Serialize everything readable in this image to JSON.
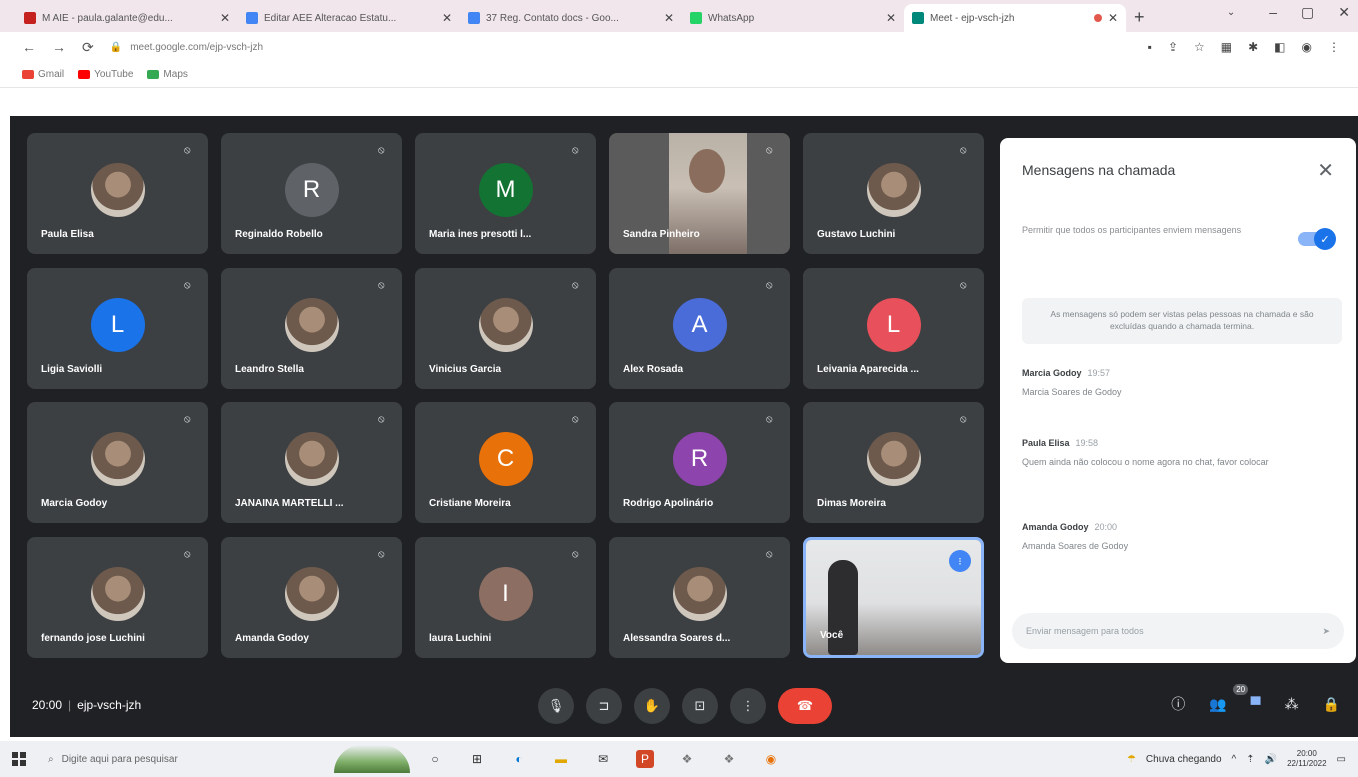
{
  "browser": {
    "tabs": [
      {
        "title": "M AIE - paula.galante@edu...",
        "color": "#c5221f"
      },
      {
        "title": "Editar AEE Alteracao Estatu...",
        "color": "#4285f4"
      },
      {
        "title": "37 Reg. Contato docs - Goo...",
        "color": "#4285f4"
      },
      {
        "title": "WhatsApp",
        "color": "#25d366"
      },
      {
        "title": "Meet - ejp-vsch-jzh",
        "color": "#00897b"
      }
    ],
    "new_tab": "+",
    "window_buttons": [
      "⌄",
      "–",
      "▢",
      "✕"
    ],
    "url": "meet.google.com/ejp-vsch-jzh",
    "bookmarks": [
      {
        "label": "Gmail",
        "color": "#ea4335"
      },
      {
        "label": "YouTube",
        "color": "#ff0000"
      },
      {
        "label": "Maps",
        "color": "#34a853"
      }
    ]
  },
  "meeting": {
    "code": "ejp-vsch-jzh",
    "time": "20:00",
    "participants": [
      {
        "name": "Paula Elisa",
        "type": "photo"
      },
      {
        "name": "Reginaldo Robello",
        "type": "initial",
        "initial": "R",
        "color": "#5f6368"
      },
      {
        "name": "Maria ines presotti l...",
        "type": "initial",
        "initial": "M",
        "color": "#137333"
      },
      {
        "name": "Sandra Pinheiro",
        "type": "video"
      },
      {
        "name": "Gustavo Luchini",
        "type": "photo"
      },
      {
        "name": "Ligia Saviolli",
        "type": "initial",
        "initial": "L",
        "color": "#1a73e8"
      },
      {
        "name": "Leandro Stella",
        "type": "photo"
      },
      {
        "name": "Vinicius Garcia",
        "type": "photo"
      },
      {
        "name": "Alex Rosada",
        "type": "initial",
        "initial": "A",
        "color": "#4a6cd8"
      },
      {
        "name": "Leivania Aparecida ...",
        "type": "initial",
        "initial": "L",
        "color": "#e8505b"
      },
      {
        "name": "Marcia Godoy",
        "type": "photo"
      },
      {
        "name": "JANAINA MARTELLI ...",
        "type": "photo"
      },
      {
        "name": "Cristiane Moreira",
        "type": "initial",
        "initial": "C",
        "color": "#e8710a"
      },
      {
        "name": "Rodrigo Apolinário",
        "type": "initial",
        "initial": "R",
        "color": "#8e44ad"
      },
      {
        "name": "Dimas Moreira",
        "type": "photo"
      },
      {
        "name": "fernando jose Luchini",
        "type": "photo"
      },
      {
        "name": "Amanda Godoy",
        "type": "photo"
      },
      {
        "name": "laura Luchini",
        "type": "initial",
        "initial": "I",
        "color": "#8d6e63"
      },
      {
        "name": "Alessandra Soares d...",
        "type": "photo"
      },
      {
        "name": "Você",
        "type": "self"
      }
    ],
    "participant_count": "20"
  },
  "chat": {
    "title": "Mensagens na chamada",
    "permission_text": "Permitir que todos os participantes enviem mensagens",
    "notice": "As mensagens só podem ser vistas pelas pessoas na chamada e são excluídas quando a chamada termina.",
    "messages": [
      {
        "sender": "Marcia Godoy",
        "time": "19:57",
        "text": "Marcia Soares de Godoy"
      },
      {
        "sender": "Paula Elisa",
        "time": "19:58",
        "text": "Quem ainda não colocou o nome agora no chat, favor colocar"
      },
      {
        "sender": "Amanda Godoy",
        "time": "20:00",
        "text": "Amanda Soares de Godoy"
      }
    ],
    "input_placeholder": "Enviar mensagem para todos",
    "send_icon": "➤"
  },
  "taskbar": {
    "search_placeholder": "Digite aqui para pesquisar",
    "weather": "Chuva chegando",
    "clock_time": "20:00",
    "clock_date": "22/11/2022"
  }
}
